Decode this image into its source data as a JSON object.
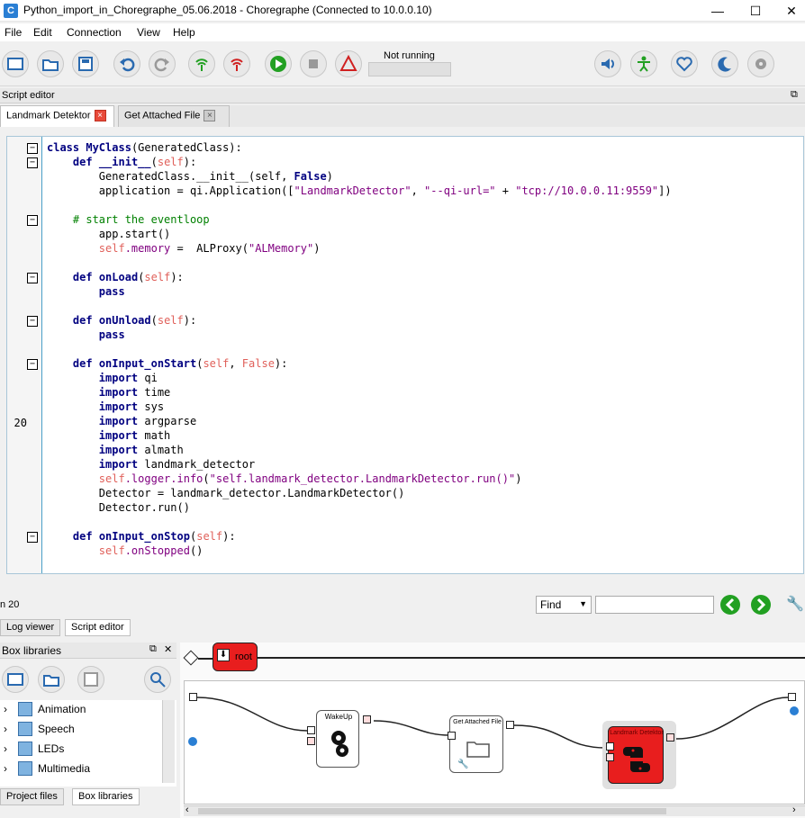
{
  "window": {
    "app_icon": "C",
    "title": "Python_import_in_Choregraphe_05.06.2018 - Choregraphe (Connected to 10.0.0.10)",
    "minimize": "—",
    "maximize": "☐",
    "close": "✕"
  },
  "menu": [
    "File",
    "Edit",
    "Connection",
    "View",
    "Help"
  ],
  "toolbar": {
    "status_label": "Not running",
    "icons": [
      "new-icon",
      "open-icon",
      "save-icon",
      "undo-icon",
      "redo-icon",
      "connect-icon",
      "disconnect-icon",
      "play-icon",
      "stop-icon",
      "warning-icon",
      "volume-icon",
      "posture-icon",
      "heart-icon",
      "moon-icon",
      "settings-icon"
    ]
  },
  "script_editor": {
    "header": "Script editor",
    "tabs": [
      {
        "label": "Landmark Detektor"
      },
      {
        "label": "Get Attached File"
      }
    ],
    "tab_close": "×",
    "current_line": "20",
    "fold_sign": "−"
  },
  "status_bar": {
    "line_text": "n 20",
    "find_label": "Find",
    "find_value": ""
  },
  "bottom_tabs": [
    "Log viewer",
    "Script editor"
  ],
  "box_libraries": {
    "header": "Box libraries",
    "items": [
      "Animation",
      "Speech",
      "LEDs",
      "Multimedia"
    ],
    "bottom_tabs": [
      "Project files",
      "Box libraries"
    ]
  },
  "flow": {
    "root_label": "root",
    "boxes": [
      "WakeUp",
      "Get Attached File",
      "Landmark Detektor"
    ]
  },
  "colors": {
    "accent_red": "#e81e1e",
    "keyword": "#000080",
    "self": "#e0605a",
    "string": "#800080",
    "comment": "#008000",
    "gutter_border": "#4aa0c8"
  }
}
